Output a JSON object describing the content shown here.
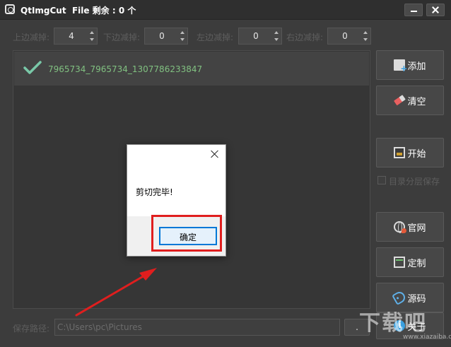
{
  "window": {
    "title": "QtImgCut  File 剩余 : 0 个"
  },
  "trim": [
    {
      "label": "上边减掉:",
      "value": "4"
    },
    {
      "label": "下边减掉:",
      "value": "0"
    },
    {
      "label": "左边减掉:",
      "value": "0"
    },
    {
      "label": "右边减掉:",
      "value": "0"
    }
  ],
  "file_list": {
    "items": [
      {
        "name": "7965734_7965734_1307786233847",
        "status": "done"
      }
    ]
  },
  "sidebar": {
    "add": "添加",
    "clear": "清空",
    "start": "开始",
    "dir_layer_save": "目录分层保存",
    "website": "官网",
    "customize": "定制",
    "source": "源码",
    "about": "关于"
  },
  "save_path": {
    "label": "保存路径:",
    "value": "C:\\Users\\pc\\Pictures",
    "browse": "."
  },
  "dialog": {
    "message": "剪切完毕!",
    "ok": "确定"
  },
  "watermark": {
    "text": "下载吧",
    "sub": "www.xiazaiba.com"
  },
  "colors": {
    "background": "#3c3c3c",
    "list_row": "#434343",
    "file_text": "#80c080",
    "check": "#79c8a8",
    "highlight": "#e01e1e",
    "ok_border": "#0078d7"
  }
}
